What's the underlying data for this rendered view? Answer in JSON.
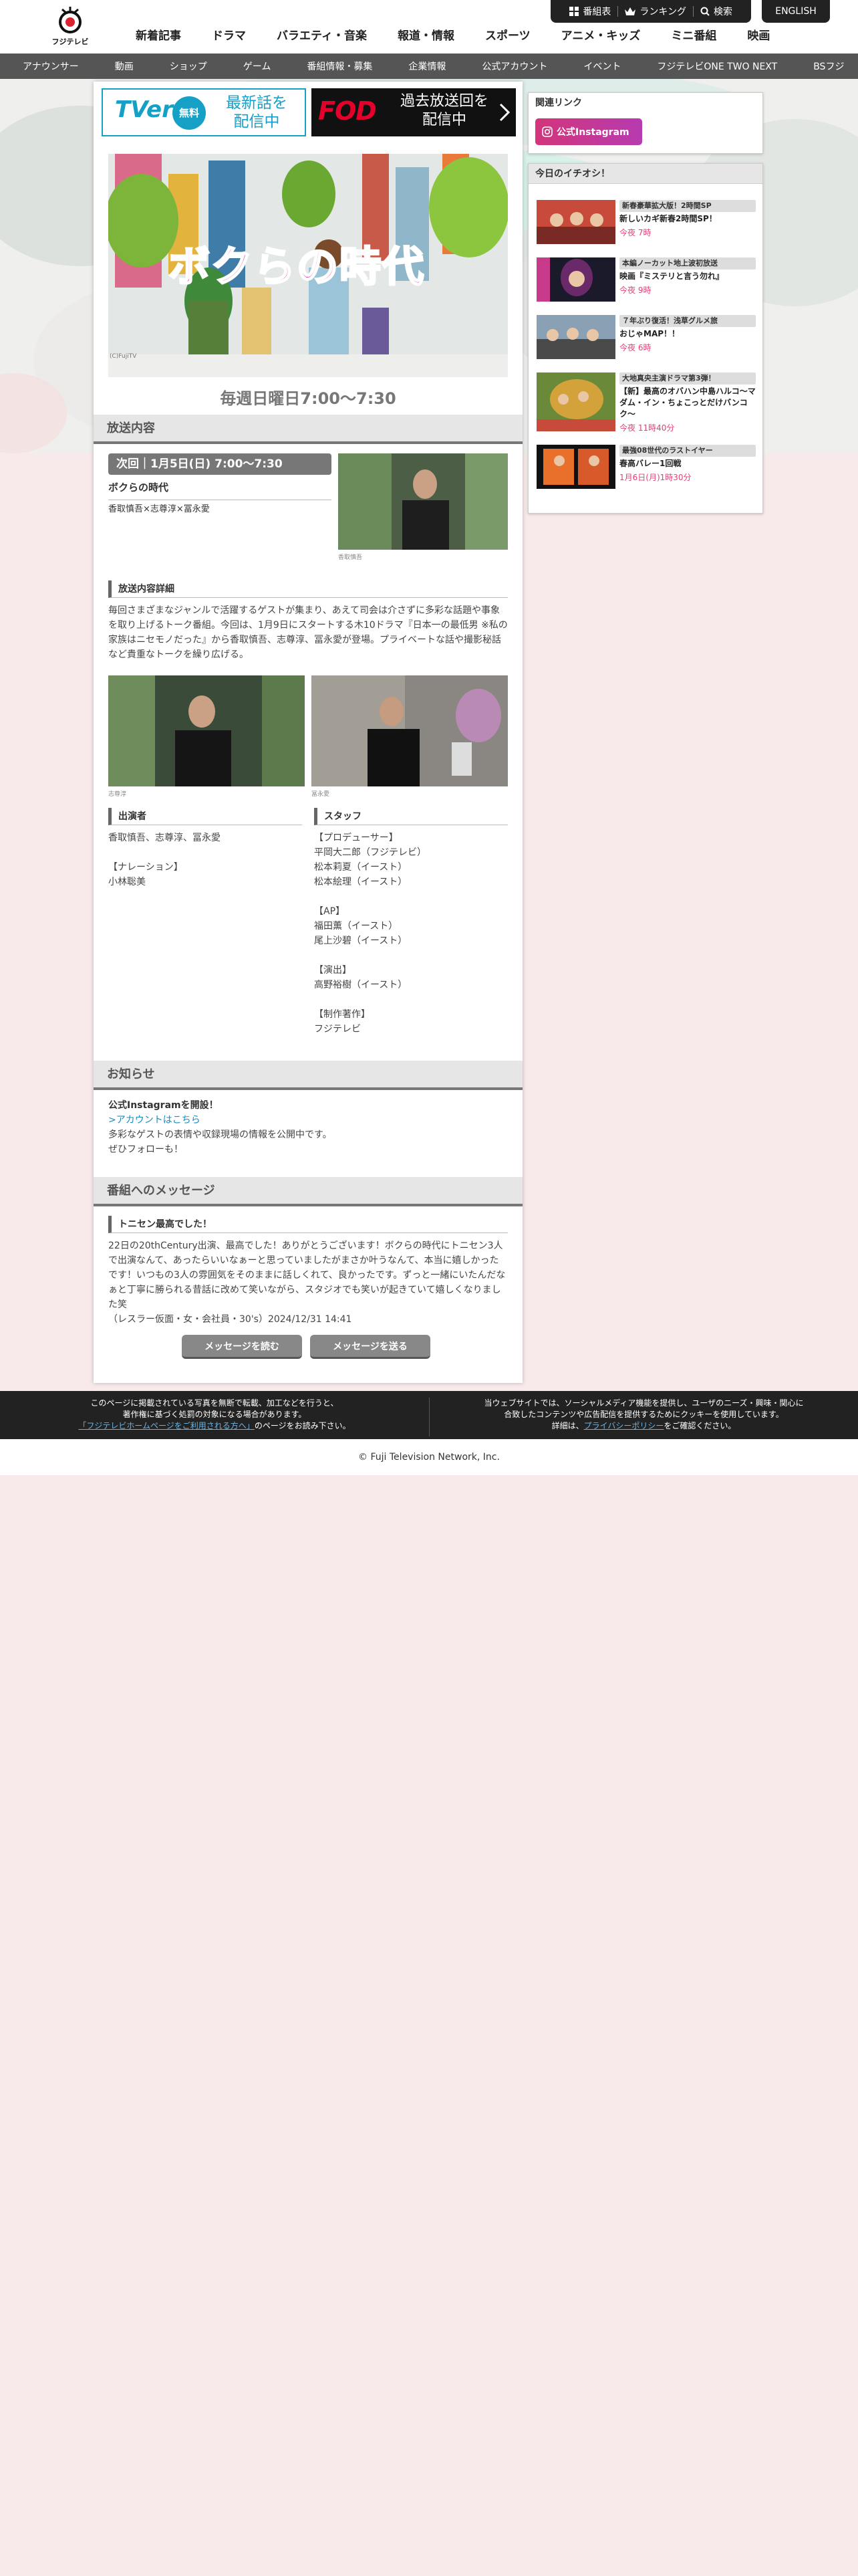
{
  "header": {
    "logo_text": "フジテレビ",
    "nav": [
      "新着記事",
      "ドラマ",
      "バラエティ・音楽",
      "報道・情報",
      "スポーツ",
      "アニメ・キッズ",
      "ミニ番組",
      "映画"
    ],
    "util": {
      "schedule": "番組表",
      "ranking": "ランキング",
      "search": "検索"
    },
    "english": "ENGLISH"
  },
  "subnav": [
    "アナウンサー",
    "動画",
    "ショップ",
    "ゲーム",
    "番組情報・募集",
    "企業情報",
    "公式アカウント",
    "イベント",
    "フジテレビONE TWO NEXT",
    "BSフジ"
  ],
  "banners": {
    "tver": {
      "brand": "TVer",
      "free": "無料",
      "text1": "最新話を",
      "text2": "配信中"
    },
    "fod": {
      "brand": "FOD",
      "text1": "過去放送回を",
      "text2": "配信中"
    }
  },
  "hero": {
    "title": "ボクらの時代",
    "credit": "(C)FujiTV"
  },
  "schedule": "毎週日曜日7:00〜7:30",
  "broadcast": {
    "heading": "放送内容",
    "next_badge": "次回｜1月5日(日) 7:00〜7:30",
    "episode_title": "ボクらの時代",
    "episode_cast": "香取慎吾×志尊淳×冨永愛",
    "photo1_caption": "香取慎吾",
    "detail_heading": "放送内容詳細",
    "detail_text": "毎回さまざまなジャンルで活躍するゲストが集まり、あえて司会は介さずに多彩な話題や事象を取り上げるトーク番組。今回は、1月9日にスタートする木10ドラマ『日本一の最低男 ※私の家族はニセモノだった』から香取慎吾、志尊淳、冨永愛が登場。プライベートな話や撮影秘話など貴重なトークを繰り広げる。",
    "photo2_caption": "志尊淳",
    "photo3_caption": "冨永愛",
    "cast_heading": "出演者",
    "cast_lines": [
      "香取慎吾、志尊淳、冨永愛",
      "",
      "【ナレーション】",
      "小林聡美"
    ],
    "staff_heading": "スタッフ",
    "staff_lines": [
      "【プロデューサー】",
      "平岡大二郎（フジテレビ）",
      "松本莉夏（イースト）",
      "松本絵理（イースト）",
      "",
      "【AP】",
      "福田薫（イースト）",
      "尾上沙碧（イースト）",
      "",
      "【演出】",
      "高野裕樹（イースト）",
      "",
      "【制作著作】",
      "フジテレビ"
    ]
  },
  "news": {
    "heading": "お知らせ",
    "title": "公式Instagramを開設！",
    "link": ">アカウントはこちら",
    "line1": "多彩なゲストの表情や収録現場の情報を公開中です。",
    "line2": "ぜひフォローも！"
  },
  "message": {
    "heading": "番組へのメッセージ",
    "sub_heading": "トニセン最高でした！",
    "text": "22日の20thCentury出演、最高でした！ありがとうございます！ボクらの時代にトニセン3人で出演なんて、あったらいいなぁーと思っていましたがまさか叶うなんて、本当に嬉しかったです！いつもの3人の雰囲気をそのままに話しくれて、良かったです。ずっと一緒にいたんだなぁと丁寧に勝られる昔話に改めて笑いながら、スタジオでも笑いが起きていて嬉しくなりました笑",
    "author": "（レスラー仮面・女・会社員・30's）2024/12/31 14:41",
    "btn_read": "メッセージを読む",
    "btn_send": "メッセージを送る"
  },
  "side": {
    "related_heading": "関連リンク",
    "insta_label": "公式Instagram",
    "picks_heading": "今日のイチオシ！",
    "picks": [
      {
        "tag": "新春豪華拡大版！2時間SP",
        "title": "新しいカギ新春2時間SP！",
        "time": "今夜 7時"
      },
      {
        "tag": "本編ノーカット地上波初放送",
        "title": "映画『ミステリと言う勿れ』",
        "time": "今夜 9時"
      },
      {
        "tag": "７年ぶり復活！浅草グルメ旅",
        "title": "おじゃMAP！！",
        "time": "今夜 6時"
      },
      {
        "tag": "大地真央主演ドラマ第3弾！",
        "title": "【新】最高のオバハン中島ハルコ〜マダム・イン・ちょこっとだけバンコク〜",
        "time": "今夜 11時40分"
      },
      {
        "tag": "最強08世代のラストイヤー",
        "title": "春高バレー1回戦",
        "time": "1月6日(月)1時30分"
      }
    ]
  },
  "footer": {
    "left1": "このページに掲載されている写真を無断で転載、加工などを行うと、",
    "left2": "著作権に基づく処罰の対象になる場合があります。",
    "left_link": "「フジテレビホームページをご利用される方へ」",
    "left3": "のページをお読み下さい。",
    "right1": "当ウェブサイトでは、ソーシャルメディア機能を提供し、ユーザのニーズ・興味・関心に",
    "right2": "合致したコンテンツや広告配信を提供するためにクッキーを使用しています。",
    "right3a": "詳細は、",
    "right_link": "プライバシーポリシー",
    "right3b": "をご確認ください。",
    "copyright": "© Fuji Television Network, Inc."
  }
}
